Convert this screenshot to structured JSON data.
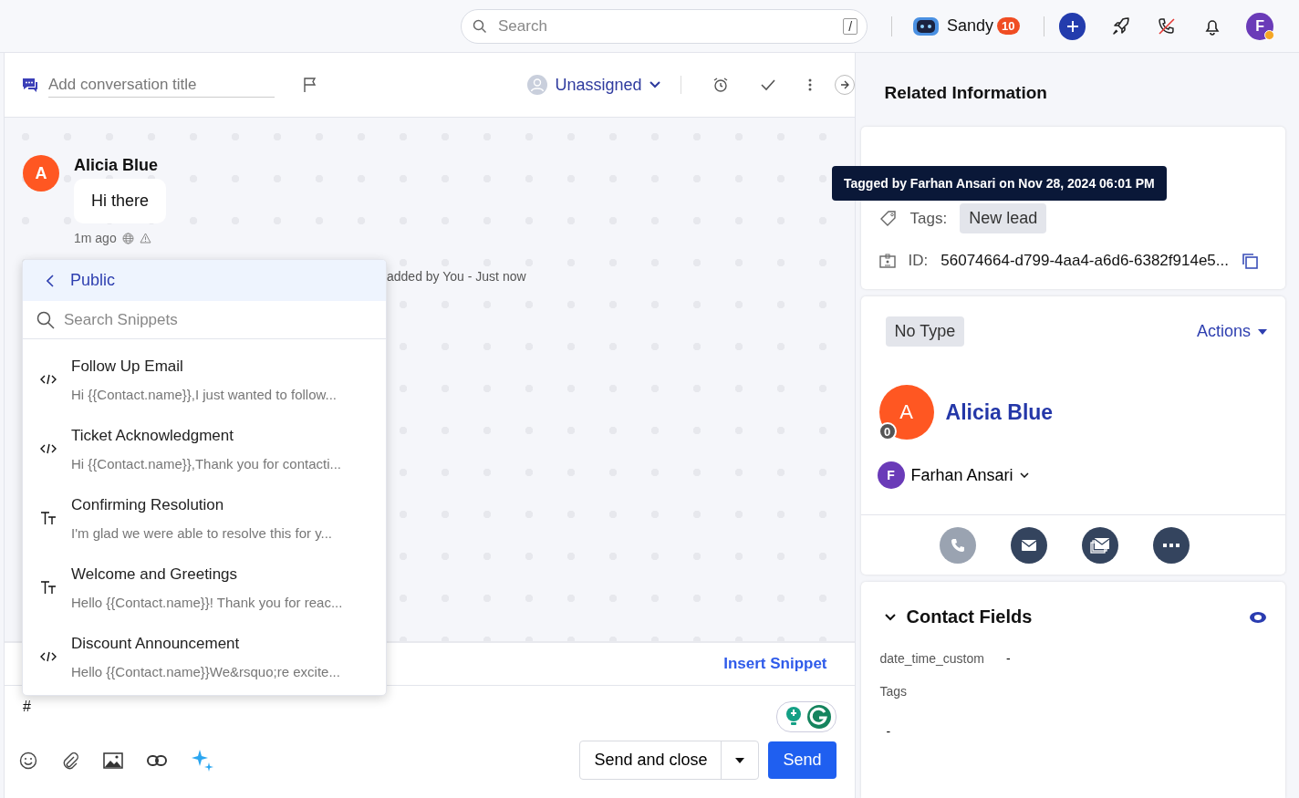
{
  "topbar": {
    "search_placeholder": "Search",
    "search_shortcut": "/",
    "user": {
      "name": "Sandy",
      "badge": "10"
    },
    "profile_initial": "F"
  },
  "conversation": {
    "title_placeholder": "Add conversation title",
    "assignee": "Unassigned"
  },
  "messages": [
    {
      "avatar": "A",
      "sender": "Alicia Blue",
      "text": "Hi there",
      "time": "1m ago"
    }
  ],
  "activity": "added by You - Just now",
  "snippet_menu": {
    "folder": "Public",
    "search_placeholder": "Search Snippets",
    "items": [
      {
        "kind": "code",
        "title": "Follow Up Email",
        "preview": "Hi {{Contact.name}},I just wanted to follow..."
      },
      {
        "kind": "code",
        "title": "Ticket Acknowledgment",
        "preview": "Hi {{Contact.name}},Thank you for contacti..."
      },
      {
        "kind": "text",
        "title": "Confirming Resolution",
        "preview": "I'm glad we were able to resolve this for y..."
      },
      {
        "kind": "text",
        "title": "Welcome and Greetings",
        "preview": "Hello {{Contact.name}}! Thank you for reac..."
      },
      {
        "kind": "code",
        "title": "Discount Announcement",
        "preview": "Hello {{Contact.name}}We&rsquo;re excite..."
      }
    ]
  },
  "composer": {
    "insert_link": "Insert Snippet",
    "text": "#",
    "send_close": "Send and close",
    "send": "Send"
  },
  "related": {
    "title": "Related Information",
    "conversation_data": {
      "tooltip": "Tagged by Farhan Ansari on Nov 28, 2024 06:01 PM",
      "tags_label": "Tags:",
      "tags": [
        "New lead"
      ],
      "id_label": "ID:",
      "id": "56074664-d799-4aa4-a6d6-6382f914e5..."
    },
    "contact": {
      "type": "No Type",
      "actions": "Actions",
      "avatar": "A",
      "badge": "0",
      "name": "Alicia Blue",
      "owner_initial": "F",
      "owner": "Farhan Ansari",
      "buttons": [
        {
          "kind": "phone",
          "disabled": true
        },
        {
          "kind": "email",
          "disabled": false
        },
        {
          "kind": "messages",
          "disabled": false
        },
        {
          "kind": "more",
          "disabled": false
        }
      ]
    },
    "contact_fields": {
      "heading": "Contact Fields",
      "fields": [
        {
          "kind": "inline",
          "label": "date_time_custom",
          "value": "-"
        },
        {
          "kind": "stacked",
          "label": "Tags",
          "value": "-"
        }
      ]
    }
  }
}
